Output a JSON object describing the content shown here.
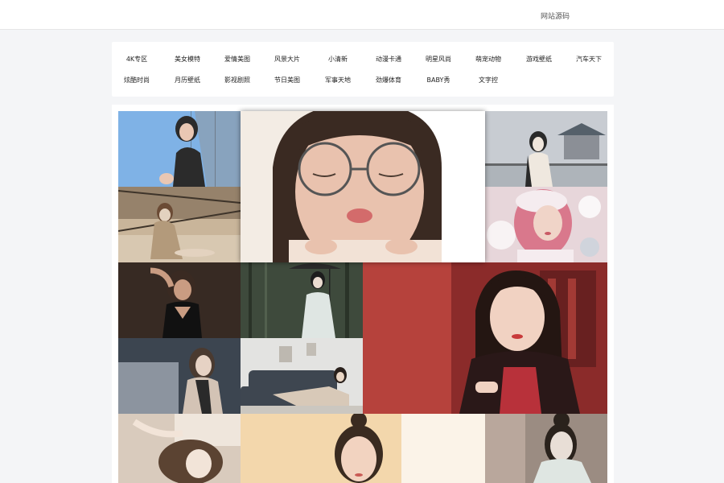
{
  "header": {
    "source_link": "网站源码"
  },
  "categories": [
    "4K专区",
    "美女模特",
    "爱情美图",
    "风景大片",
    "小清新",
    "动漫卡通",
    "明星风尚",
    "萌宠动物",
    "游戏壁纸",
    "汽车天下",
    "炫酷时尚",
    "月历壁纸",
    "影视剧照",
    "节日美图",
    "军事天地",
    "劲爆体育",
    "BABY秀",
    "文字控"
  ],
  "gallery": {
    "tiles": [
      {
        "name": "photo-girl-fence",
        "palette": [
          "#7fb2e6",
          "#2b2b2b",
          "#e9c7b3"
        ]
      },
      {
        "name": "photo-girl-glasses-featured",
        "palette": [
          "#f3ece4",
          "#3a2a22",
          "#e9c2ae"
        ]
      },
      {
        "name": "photo-girl-pavilion",
        "palette": [
          "#c8ccd2",
          "#2a2a2a",
          "#f0e6dc"
        ]
      },
      {
        "name": "photo-girl-bridge-sitting",
        "palette": [
          "#c9b59a",
          "#6b5846",
          "#e3d2bf"
        ]
      },
      {
        "name": "photo-girl-pink-hair-snow",
        "palette": [
          "#e7d6da",
          "#d9788c",
          "#f5ecef"
        ]
      },
      {
        "name": "photo-woman-black-dress",
        "palette": [
          "#2a211c",
          "#4a3a30",
          "#c99c82"
        ]
      },
      {
        "name": "photo-girl-umbrella-forest",
        "palette": [
          "#3e4a3c",
          "#dfe6e3",
          "#2a3328"
        ]
      },
      {
        "name": "photo-girl-hanfu-red",
        "palette": [
          "#8b2b2a",
          "#c94d44",
          "#f1d2c2"
        ]
      },
      {
        "name": "photo-girl-scarf",
        "palette": [
          "#3c4550",
          "#d3c3b5",
          "#2a2a2a"
        ]
      },
      {
        "name": "photo-girl-sofa",
        "palette": [
          "#e3e3e1",
          "#3e4650",
          "#ead6c4"
        ]
      },
      {
        "name": "photo-girl-lying",
        "palette": [
          "#d9cbbd",
          "#5b4332",
          "#f2e4d8"
        ]
      },
      {
        "name": "photo-girl-beige-bg",
        "palette": [
          "#f3d7ac",
          "#3a2b20",
          "#f2d3c0"
        ]
      },
      {
        "name": "photo-girl-white-hanfu",
        "palette": [
          "#9b8c82",
          "#2a221c",
          "#e8ded6"
        ]
      }
    ]
  }
}
